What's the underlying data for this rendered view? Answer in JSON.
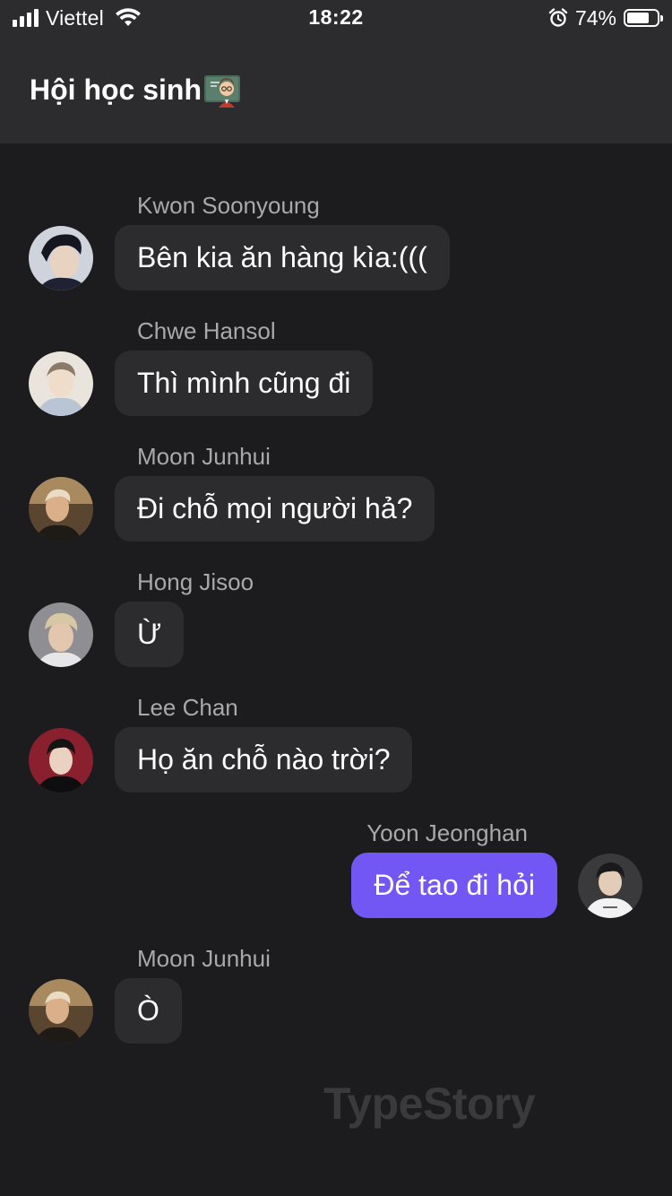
{
  "status_bar": {
    "carrier": "Viettel",
    "time": "18:22",
    "battery_percent": "74%",
    "battery_level": 0.74,
    "signal_bars": 4,
    "icons": [
      "signal-icon",
      "wifi-icon",
      "alarm-icon",
      "battery-icon"
    ]
  },
  "header": {
    "title": "Hội học sinh",
    "emoji_icon": "teacher-emoji-icon"
  },
  "messages": [
    {
      "sender": "Kwon Soonyoung",
      "text": "Bên kia ăn hàng kìa:(((",
      "side": "left"
    },
    {
      "sender": "Chwe Hansol",
      "text": "Thì mình cũng đi",
      "side": "left"
    },
    {
      "sender": "Moon Junhui",
      "text": "Đi chỗ mọi người hả?",
      "side": "left"
    },
    {
      "sender": "Hong Jisoo",
      "text": "Ừ",
      "side": "left"
    },
    {
      "sender": "Lee Chan",
      "text": "Họ ăn chỗ nào trời?",
      "side": "left"
    },
    {
      "sender": "Yoon Jeonghan",
      "text": "Để tao đi hỏi",
      "side": "right"
    },
    {
      "sender": "Moon Junhui",
      "text": "Ò",
      "side": "left"
    }
  ],
  "watermark": "TypeStory",
  "colors": {
    "background": "#1c1c1e",
    "header": "#2c2c2e",
    "bubble_other": "#2c2c2e",
    "bubble_self": "#7257f5",
    "sender_name": "#a8a8ad"
  }
}
